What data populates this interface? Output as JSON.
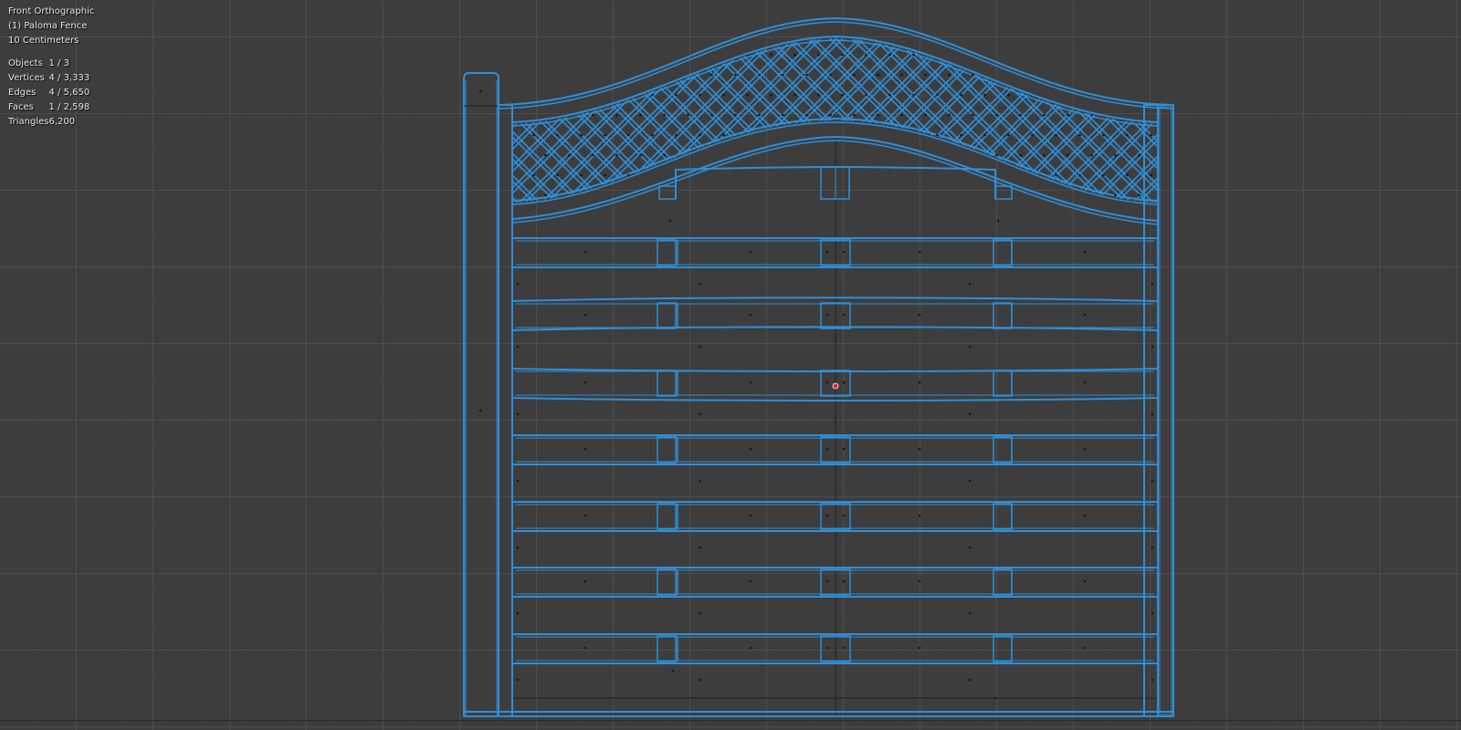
{
  "viewport": {
    "view_name": "Front Orthographic",
    "active_object": "(1) Paloma Fence",
    "grid_scale": "10 Centimeters",
    "stats": [
      {
        "label": "Objects",
        "value": "1 / 3"
      },
      {
        "label": "Vertices",
        "value": "4 / 3,333"
      },
      {
        "label": "Edges",
        "value": "4 / 5,650"
      },
      {
        "label": "Faces",
        "value": "1 / 2,598"
      },
      {
        "label": "Triangles",
        "value": "6,200"
      }
    ]
  },
  "colors": {
    "background": "#3d3d3d",
    "grid": "#555555",
    "selected_wire": "#2f8fd8",
    "unselected_wire": "#1e1e1e",
    "origin": "#e0203a"
  },
  "icons": {
    "origin": "origin-dot-icon"
  }
}
